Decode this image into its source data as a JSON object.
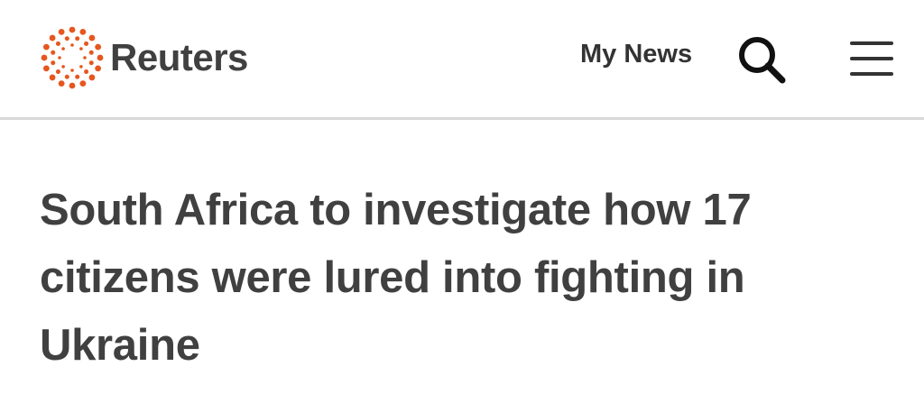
{
  "header": {
    "logo_text": "Reuters",
    "logo_icon": "reuters-dot-ring-logo",
    "my_news_label": "My News",
    "search_icon": "search-icon",
    "menu_icon": "hamburger-menu-icon"
  },
  "article": {
    "headline": "South Africa to investigate how 17 citizens were lured into fighting in Ukraine"
  },
  "colors": {
    "brand_orange": "#e6561f",
    "text_dark": "#404040",
    "divider": "#d9d9d9"
  }
}
